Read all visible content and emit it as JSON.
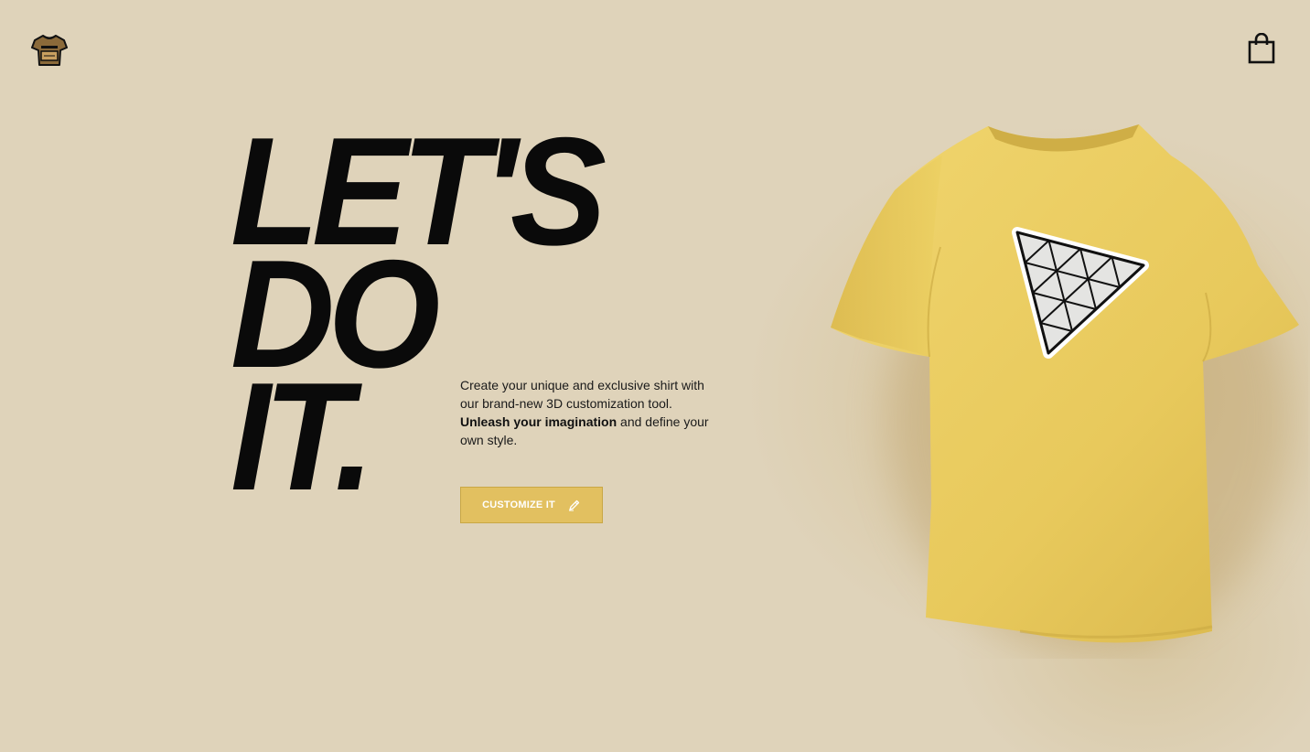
{
  "header": {
    "logo_icon": "tshirt-logo-icon",
    "cart_icon": "shopping-bag-icon"
  },
  "hero": {
    "headline": {
      "line1": "LET'S",
      "line2": "DO",
      "line3": "IT."
    },
    "description": {
      "part1": "Create your unique and exclusive shirt with our brand-new 3D customization tool.",
      "emphasis": "Unleash your imagination",
      "part2": "and define your own style."
    },
    "cta": {
      "label": "CUSTOMIZE IT",
      "icon": "pencil-icon"
    }
  },
  "product": {
    "image": "yellow-tshirt-3d-model",
    "decal": "triangle-logo-decal"
  },
  "colors": {
    "background": "#dfd3ba",
    "accent": "#e2c060",
    "shirt": "#ebcf63",
    "text": "#111111"
  }
}
